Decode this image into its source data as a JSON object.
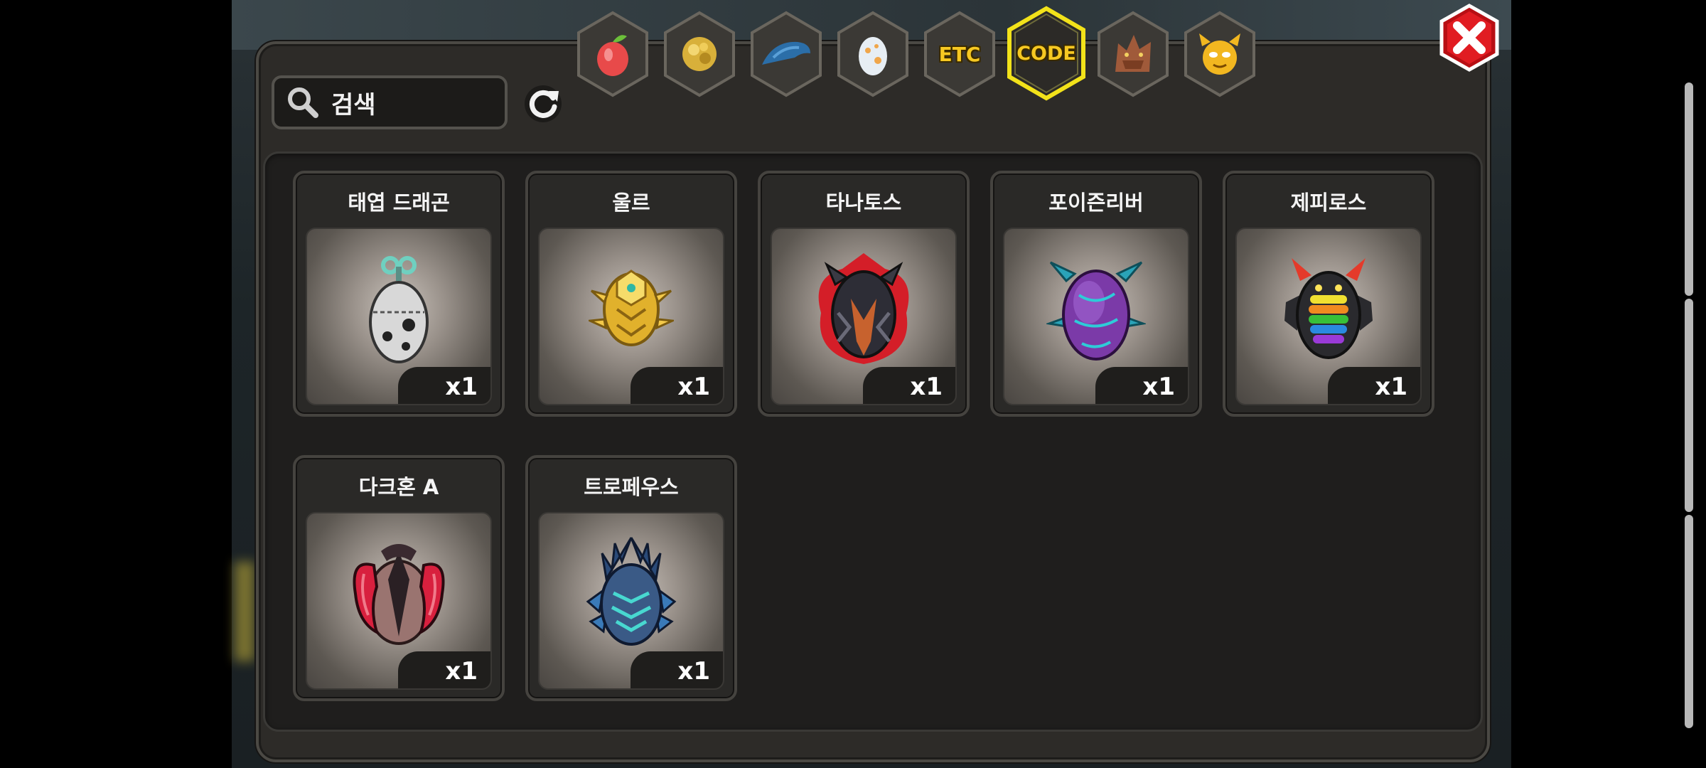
{
  "search": {
    "placeholder": "검색"
  },
  "tabs": [
    {
      "name": "fruit-tab-icon"
    },
    {
      "name": "gold-tab-icon"
    },
    {
      "name": "dragon-tab-icon"
    },
    {
      "name": "egg-tab-icon"
    },
    {
      "name": "etc-tab",
      "label": "ETC"
    },
    {
      "name": "code-tab",
      "label": "CODE",
      "selected": true
    },
    {
      "name": "beast-tab-icon"
    },
    {
      "name": "demon-tab-icon"
    }
  ],
  "items": [
    {
      "name": "태엽 드래곤",
      "qty": "x1",
      "icon": "clockwork-egg-icon"
    },
    {
      "name": "울르",
      "qty": "x1",
      "icon": "golden-egg-icon"
    },
    {
      "name": "타나토스",
      "qty": "x1",
      "icon": "thanatos-egg-icon"
    },
    {
      "name": "포이즌리버",
      "qty": "x1",
      "icon": "poison-egg-icon"
    },
    {
      "name": "제피로스",
      "qty": "x1",
      "icon": "rainbow-egg-icon"
    },
    {
      "name": "다크혼 A",
      "qty": "x1",
      "icon": "darkhorn-egg-icon"
    },
    {
      "name": "트로페우스",
      "qty": "x1",
      "icon": "tropaeus-egg-icon"
    }
  ],
  "colors": {
    "accent": "#f6c822",
    "close": "#d8151b",
    "panel": "#2d2b28"
  }
}
